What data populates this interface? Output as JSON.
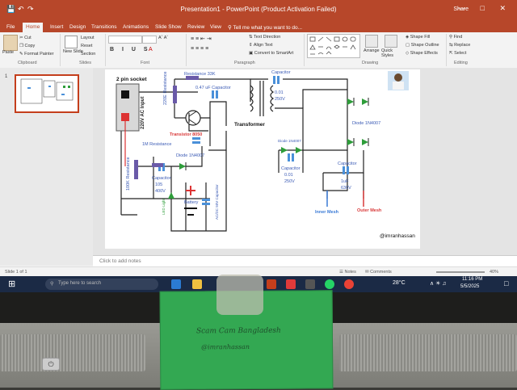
{
  "window": {
    "title": "Presentation1 - PowerPoint (Product Activation Failed)",
    "user_name": "Share"
  },
  "ribbon_tabs": [
    "File",
    "Home",
    "Insert",
    "Design",
    "Transitions",
    "Animations",
    "Slide Show",
    "Review",
    "View"
  ],
  "tell_me": "Tell me what you want to do...",
  "ribbon": {
    "clipboard": {
      "paste": "Paste",
      "cut": "Cut",
      "copy": "Copy",
      "format_painter": "Format Painter",
      "group": "Clipboard"
    },
    "slides": {
      "new_slide": "New Slide",
      "layout": "Layout",
      "reset": "Reset",
      "section": "Section",
      "group": "Slides"
    },
    "font": {
      "group": "Font"
    },
    "paragraph": {
      "text_direction": "Text Direction",
      "align_text": "Align Text",
      "convert_smartart": "Convert to SmartArt",
      "group": "Paragraph"
    },
    "drawing": {
      "arrange": "Arrange",
      "quick_styles": "Quick Styles",
      "shape_fill": "Shape Fill",
      "shape_outline": "Shape Outline",
      "shape_effects": "Shape Effects",
      "group": "Drawing"
    },
    "editing": {
      "find": "Find",
      "replace": "Replace",
      "select": "Select",
      "group": "Editing"
    }
  },
  "slide": {
    "labels": {
      "socket": "2 pin socket",
      "ac_input": "220V AC Input",
      "resistance_33k": "Resistance 33K",
      "r220e": "220E Resistance",
      "cap_473": "0.47 uF Capacitor",
      "transistor": "Transistor 8050",
      "transformer": "Transformer",
      "cap_top": "Capacitor",
      "cap_top_v1": "0.01",
      "cap_top_v2": "250V",
      "diode_1n4007": "Diode 1N4007",
      "diode_sm": "Diode 1N4007",
      "cap_mid": "Capacitor",
      "cap_mid_v1": "0.01",
      "cap_mid_v2": "250V",
      "cap_right": "Capacitor",
      "cap_right_v1": "1uF",
      "cap_right_v2": "630V",
      "inner_mesh": "Inner Mesh",
      "outer_mesh": "Outer Mesh",
      "res_1m": "1M Resistance",
      "diode_left": "Diode 1N4007",
      "res_100k": "100K Resistance",
      "cap_105_name": "Capacitor",
      "cap_105_v1": "105",
      "cap_105_v2": "400V",
      "led": "LED Light",
      "battery": "Battery",
      "cap_small": "AC/DC 50V Capacitor",
      "author": "@imranhassan"
    }
  },
  "notes_placeholder": "Click to add notes",
  "status": {
    "slide": "Slide 1 of 1",
    "notes": "Notes",
    "comments": "Comments",
    "zoom": "40%"
  },
  "taskbar": {
    "search_placeholder": "Type here to search",
    "temp": "28°C",
    "time": "11:16 PM",
    "date": "5/5/2025"
  },
  "sticky_note": {
    "line1": "Scam Cam Bangladesh",
    "line2": "@imranhassan"
  },
  "colors": {
    "accent": "#b7472a",
    "note": "#33a852",
    "wire": "#222222",
    "capacitor": "#4a90d9",
    "diode": "#2e9d3a",
    "resistor": "#6a5aa8",
    "mesh_inner": "#3b7bd6",
    "mesh_outer": "#d93a3a"
  }
}
